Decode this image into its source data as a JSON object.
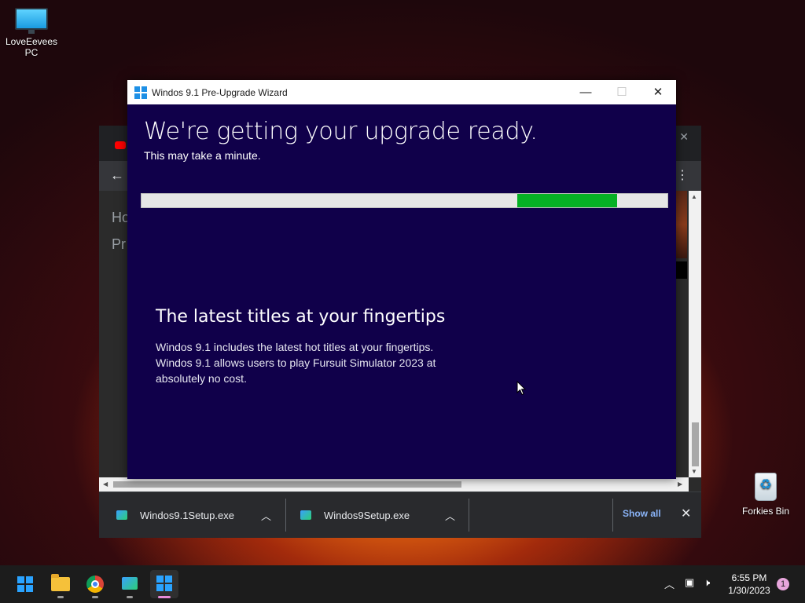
{
  "desktop": {
    "icons": [
      {
        "label": "LoveEevees PC",
        "icon": "monitor-icon"
      },
      {
        "label": "Forkies Bin",
        "icon": "recycle-bin-icon"
      }
    ]
  },
  "wizard": {
    "title": "Windos 9.1 Pre-Upgrade Wizard",
    "controls": {
      "minimize": "—",
      "maximize": "☐",
      "close": "✕"
    },
    "heading": "We're getting your upgrade ready.",
    "subheading": "This may take a minute.",
    "progress": {
      "start_fraction": 0.714,
      "end_fraction": 0.904,
      "color": "#06b025"
    },
    "feature": {
      "title": "The latest titles at your fingertips",
      "body": "Windos 9.1 includes the latest hot titles at your fingertips. Windos 9.1 allows users to play Fursuit Simulator 2023 at absolutely no cost."
    },
    "background_color": "#10004a"
  },
  "browser": {
    "sidebar_items": [
      "Ho",
      "Pr"
    ],
    "downloads": [
      {
        "filename": "Windos9.1Setup.exe"
      },
      {
        "filename": "Windos9Setup.exe"
      }
    ],
    "show_all_label": "Show all",
    "close_label": "✕"
  },
  "taskbar": {
    "apps": [
      "start-icon",
      "file-explorer-icon",
      "chrome-icon",
      "setup-icon",
      "windos-wizard-icon"
    ],
    "time": "6:55 PM",
    "date": "1/30/2023",
    "notification_count": "1"
  }
}
